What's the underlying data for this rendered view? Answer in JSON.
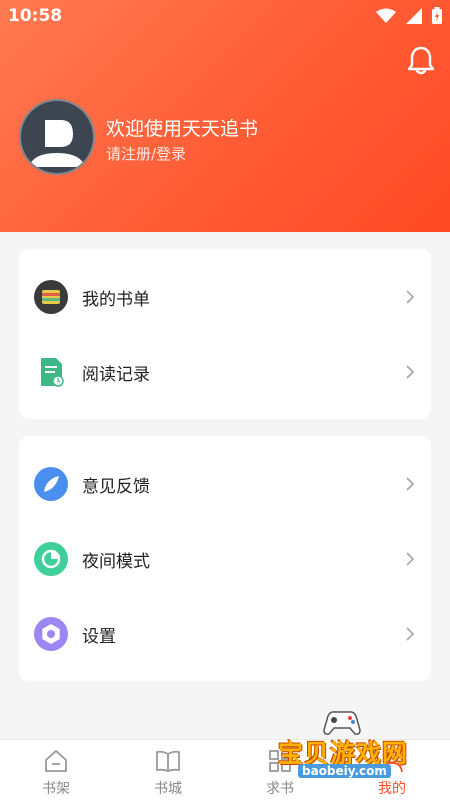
{
  "status_bar": {
    "time": "10:58"
  },
  "profile": {
    "welcome_text": "欢迎使用天天追书",
    "login_text": "请注册/登录"
  },
  "menu_group_1": [
    {
      "label": "我的书单",
      "icon": "booklist-icon"
    },
    {
      "label": "阅读记录",
      "icon": "reading-record-icon"
    }
  ],
  "menu_group_2": [
    {
      "label": "意见反馈",
      "icon": "feedback-icon"
    },
    {
      "label": "夜间模式",
      "icon": "night-mode-icon"
    },
    {
      "label": "设置",
      "icon": "settings-icon"
    }
  ],
  "bottom_nav": [
    {
      "label": "书架",
      "icon": "bookshelf-icon"
    },
    {
      "label": "书城",
      "icon": "bookstore-icon"
    },
    {
      "label": "求书",
      "icon": "request-book-icon"
    },
    {
      "label": "我的",
      "icon": "profile-icon",
      "active": true
    }
  ],
  "watermark": {
    "text": "宝贝游戏网",
    "url": "baobeiy.com"
  },
  "colors": {
    "accent": "#ff5030",
    "header_start": "#ff7a52",
    "header_end": "#ff4a25"
  }
}
